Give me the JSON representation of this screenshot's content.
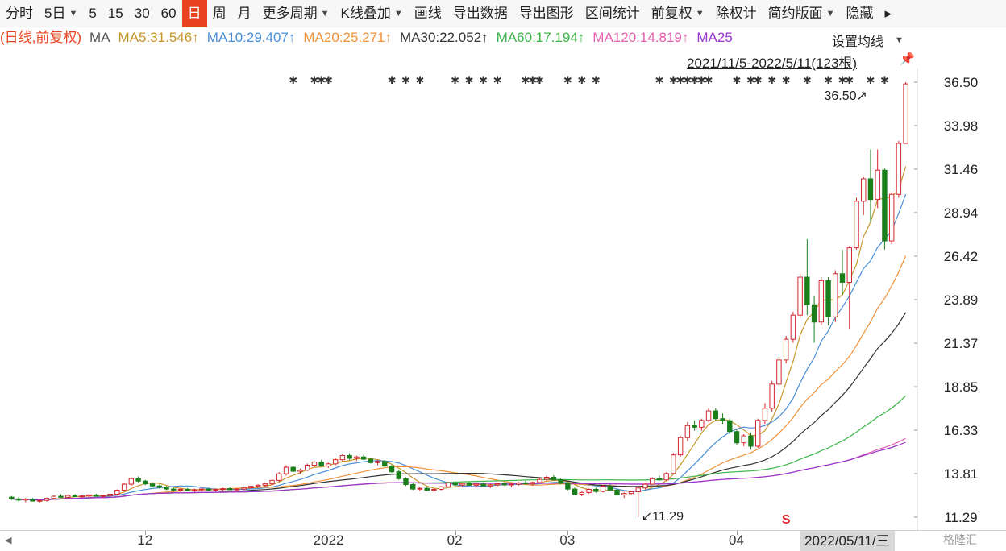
{
  "toolbar": {
    "items": [
      {
        "label": "分时",
        "dropdown": false,
        "active": false
      },
      {
        "label": "5日",
        "dropdown": true,
        "active": false
      },
      {
        "label": "5",
        "dropdown": false,
        "active": false
      },
      {
        "label": "15",
        "dropdown": false,
        "active": false
      },
      {
        "label": "30",
        "dropdown": false,
        "active": false
      },
      {
        "label": "60",
        "dropdown": false,
        "active": false
      },
      {
        "label": "日",
        "dropdown": false,
        "active": true
      },
      {
        "label": "周",
        "dropdown": false,
        "active": false
      },
      {
        "label": "月",
        "dropdown": false,
        "active": false
      },
      {
        "label": "更多周期",
        "dropdown": true,
        "active": false
      },
      {
        "label": "K线叠加",
        "dropdown": true,
        "active": false
      },
      {
        "label": "画线",
        "dropdown": false,
        "active": false
      },
      {
        "label": "导出数据",
        "dropdown": false,
        "active": false
      },
      {
        "label": "导出图形",
        "dropdown": false,
        "active": false
      },
      {
        "label": "区间统计",
        "dropdown": false,
        "active": false
      },
      {
        "label": "前复权",
        "dropdown": true,
        "active": false
      },
      {
        "label": "除权计",
        "dropdown": false,
        "active": false
      },
      {
        "label": "简约版面",
        "dropdown": true,
        "active": false
      },
      {
        "label": "隐藏",
        "dropdown": false,
        "active": false
      }
    ]
  },
  "legend": {
    "prefix": "(日线,前复权)",
    "ma_label": "MA",
    "items": [
      {
        "text": "MA5:31.546↑",
        "color": "#c8962c"
      },
      {
        "text": "MA10:29.407↑",
        "color": "#4a8fd8"
      },
      {
        "text": "MA20:25.271↑",
        "color": "#f0923a"
      },
      {
        "text": "MA30:22.052↑",
        "color": "#333333"
      },
      {
        "text": "MA60:17.194↑",
        "color": "#3bb548"
      },
      {
        "text": "MA120:14.819↑",
        "color": "#e561b0"
      },
      {
        "text": "MA25",
        "color": "#9933cc"
      }
    ]
  },
  "ma_settings_label": "设置均线",
  "range_label": "2021/11/5-2022/5/11(123根)",
  "date_badge": "2022/05/11/三",
  "watermark": "格隆汇",
  "colors": {
    "up": "#d3262e",
    "down": "#1a7f1a",
    "prefix": "#e8431f"
  },
  "chart_data": {
    "type": "candlestick",
    "y_ticks": [
      "36.50",
      "33.98",
      "31.46",
      "28.94",
      "26.42",
      "23.89",
      "21.37",
      "18.85",
      "16.33",
      "13.81",
      "11.29"
    ],
    "ylim": [
      11.29,
      36.5
    ],
    "x_ticks": [
      {
        "label": "12",
        "index": 19
      },
      {
        "label": "2022",
        "index": 44
      },
      {
        "label": "02",
        "index": 63
      },
      {
        "label": "03",
        "index": 79
      },
      {
        "label": "04",
        "index": 103
      }
    ],
    "annotations": [
      {
        "text": "36.50↗",
        "index": 122,
        "value": 36.5,
        "kind": "high"
      },
      {
        "text": "↙11.29",
        "index": 89,
        "value": 11.29,
        "kind": "low"
      },
      {
        "text": "S",
        "index": 110,
        "value": 11.29,
        "kind": "marker"
      }
    ],
    "news_marker_indices": [
      40,
      43,
      44,
      45,
      54,
      56,
      58,
      63,
      65,
      67,
      69,
      73,
      74,
      75,
      79,
      81,
      83,
      92,
      94,
      95,
      96,
      97,
      98,
      99,
      103,
      105,
      106,
      108,
      110,
      113,
      116,
      118,
      119,
      122,
      124
    ],
    "ohlc": [
      [
        12.45,
        12.52,
        12.28,
        12.35
      ],
      [
        12.35,
        12.45,
        12.2,
        12.28
      ],
      [
        12.28,
        12.4,
        12.15,
        12.34
      ],
      [
        12.34,
        12.4,
        12.2,
        12.22
      ],
      [
        12.22,
        12.32,
        12.14,
        12.26
      ],
      [
        12.26,
        12.42,
        12.2,
        12.38
      ],
      [
        12.38,
        12.55,
        12.3,
        12.5
      ],
      [
        12.5,
        12.62,
        12.4,
        12.44
      ],
      [
        12.44,
        12.58,
        12.38,
        12.55
      ],
      [
        12.55,
        12.62,
        12.45,
        12.48
      ],
      [
        12.48,
        12.56,
        12.4,
        12.52
      ],
      [
        12.52,
        12.62,
        12.46,
        12.58
      ],
      [
        12.58,
        12.65,
        12.48,
        12.5
      ],
      [
        12.5,
        12.58,
        12.42,
        12.54
      ],
      [
        12.54,
        12.66,
        12.5,
        12.62
      ],
      [
        12.62,
        12.9,
        12.55,
        12.85
      ],
      [
        12.85,
        13.25,
        12.78,
        13.2
      ],
      [
        13.2,
        13.6,
        13.1,
        13.52
      ],
      [
        13.52,
        13.65,
        13.3,
        13.38
      ],
      [
        13.38,
        13.45,
        13.15,
        13.22
      ],
      [
        13.22,
        13.3,
        13.05,
        13.1
      ],
      [
        13.1,
        13.18,
        12.95,
        13.02
      ],
      [
        13.02,
        13.1,
        12.86,
        12.92
      ],
      [
        12.92,
        13.0,
        12.8,
        12.86
      ],
      [
        12.86,
        12.96,
        12.78,
        12.9
      ],
      [
        12.9,
        12.98,
        12.8,
        12.84
      ],
      [
        12.84,
        12.94,
        12.76,
        12.88
      ],
      [
        12.88,
        12.98,
        12.8,
        12.92
      ],
      [
        12.92,
        13.0,
        12.82,
        12.86
      ],
      [
        12.86,
        12.96,
        12.78,
        12.9
      ],
      [
        12.9,
        13.0,
        12.82,
        12.94
      ],
      [
        12.94,
        13.02,
        12.85,
        12.88
      ],
      [
        12.88,
        12.98,
        12.8,
        12.92
      ],
      [
        12.92,
        13.05,
        12.86,
        13.0
      ],
      [
        13.0,
        13.12,
        12.92,
        13.08
      ],
      [
        13.08,
        13.2,
        13.0,
        13.14
      ],
      [
        13.14,
        13.3,
        13.05,
        13.22
      ],
      [
        13.22,
        13.5,
        13.15,
        13.42
      ],
      [
        13.42,
        13.9,
        13.35,
        13.8
      ],
      [
        13.8,
        14.3,
        13.7,
        14.18
      ],
      [
        14.18,
        14.25,
        13.9,
        13.95
      ],
      [
        13.95,
        14.1,
        13.8,
        14.02
      ],
      [
        14.02,
        14.4,
        13.95,
        14.3
      ],
      [
        14.3,
        14.55,
        14.2,
        14.48
      ],
      [
        14.48,
        14.6,
        14.2,
        14.25
      ],
      [
        14.25,
        14.45,
        14.15,
        14.38
      ],
      [
        14.38,
        14.7,
        14.3,
        14.62
      ],
      [
        14.62,
        14.95,
        14.5,
        14.86
      ],
      [
        14.86,
        15.0,
        14.6,
        14.7
      ],
      [
        14.7,
        14.85,
        14.55,
        14.78
      ],
      [
        14.78,
        14.9,
        14.6,
        14.65
      ],
      [
        14.65,
        14.72,
        14.4,
        14.45
      ],
      [
        14.45,
        14.6,
        14.3,
        14.52
      ],
      [
        14.52,
        14.6,
        14.2,
        14.25
      ],
      [
        14.25,
        14.32,
        13.85,
        13.92
      ],
      [
        13.92,
        14.0,
        13.45,
        13.52
      ],
      [
        13.52,
        13.6,
        13.1,
        13.18
      ],
      [
        13.18,
        13.25,
        12.85,
        12.92
      ],
      [
        12.92,
        13.02,
        12.78,
        12.96
      ],
      [
        12.96,
        13.05,
        12.8,
        12.85
      ],
      [
        12.85,
        12.96,
        12.7,
        12.9
      ],
      [
        12.9,
        13.1,
        12.84,
        13.05
      ],
      [
        13.05,
        13.35,
        13.0,
        13.28
      ],
      [
        13.28,
        13.4,
        13.1,
        13.16
      ],
      [
        13.16,
        13.3,
        13.05,
        13.24
      ],
      [
        13.24,
        13.34,
        13.1,
        13.14
      ],
      [
        13.14,
        13.26,
        13.0,
        13.2
      ],
      [
        13.2,
        13.3,
        13.05,
        13.1
      ],
      [
        13.1,
        13.22,
        12.98,
        13.16
      ],
      [
        13.16,
        13.28,
        13.05,
        13.22
      ],
      [
        13.22,
        13.32,
        13.1,
        13.16
      ],
      [
        13.16,
        13.26,
        13.02,
        13.2
      ],
      [
        13.2,
        13.34,
        13.1,
        13.28
      ],
      [
        13.28,
        13.4,
        13.18,
        13.22
      ],
      [
        13.22,
        13.35,
        13.12,
        13.3
      ],
      [
        13.3,
        13.55,
        13.25,
        13.48
      ],
      [
        13.48,
        13.7,
        13.38,
        13.6
      ],
      [
        13.6,
        13.72,
        13.4,
        13.46
      ],
      [
        13.46,
        13.55,
        13.2,
        13.25
      ],
      [
        13.25,
        13.3,
        12.85,
        12.92
      ],
      [
        12.92,
        13.0,
        12.55,
        12.62
      ],
      [
        12.62,
        12.8,
        12.5,
        12.72
      ],
      [
        12.72,
        12.95,
        12.65,
        12.9
      ],
      [
        12.9,
        13.0,
        12.7,
        12.78
      ],
      [
        12.78,
        13.15,
        12.72,
        13.08
      ],
      [
        13.08,
        13.2,
        12.8,
        12.86
      ],
      [
        12.86,
        12.92,
        12.5,
        12.58
      ],
      [
        12.58,
        12.72,
        12.4,
        12.66
      ],
      [
        12.66,
        12.82,
        12.58,
        12.76
      ],
      [
        12.76,
        13.05,
        11.29,
        12.98
      ],
      [
        12.98,
        13.25,
        12.9,
        13.2
      ],
      [
        13.2,
        13.6,
        13.15,
        13.52
      ],
      [
        13.52,
        13.7,
        13.4,
        13.45
      ],
      [
        13.45,
        13.9,
        13.4,
        13.82
      ],
      [
        13.82,
        15.0,
        13.8,
        14.9
      ],
      [
        14.9,
        16.0,
        14.8,
        15.9
      ],
      [
        15.9,
        16.8,
        15.7,
        16.6
      ],
      [
        16.6,
        16.9,
        16.3,
        16.5
      ],
      [
        16.5,
        17.0,
        16.3,
        16.9
      ],
      [
        16.9,
        17.6,
        16.8,
        17.45
      ],
      [
        17.45,
        17.6,
        16.9,
        17.0
      ],
      [
        17.0,
        17.3,
        16.7,
        16.88
      ],
      [
        16.88,
        17.0,
        16.1,
        16.25
      ],
      [
        16.25,
        16.4,
        15.5,
        15.6
      ],
      [
        15.6,
        16.1,
        15.4,
        16.0
      ],
      [
        16.0,
        16.2,
        15.2,
        15.4
      ],
      [
        15.4,
        17.0,
        15.3,
        16.9
      ],
      [
        16.9,
        17.9,
        16.7,
        17.6
      ],
      [
        17.6,
        19.2,
        17.4,
        19.0
      ],
      [
        19.0,
        20.6,
        18.8,
        20.4
      ],
      [
        20.4,
        21.8,
        20.2,
        21.6
      ],
      [
        21.6,
        23.2,
        21.4,
        23.0
      ],
      [
        23.0,
        25.4,
        22.8,
        25.2
      ],
      [
        25.2,
        27.4,
        23.0,
        23.6
      ],
      [
        23.6,
        24.1,
        21.4,
        22.6
      ],
      [
        22.6,
        25.2,
        22.4,
        25.0
      ],
      [
        25.0,
        25.2,
        22.4,
        22.9
      ],
      [
        22.9,
        25.6,
        22.6,
        25.4
      ],
      [
        25.4,
        26.8,
        24.2,
        24.9
      ],
      [
        24.9,
        27.0,
        22.2,
        26.9
      ],
      [
        26.9,
        29.8,
        26.8,
        29.6
      ],
      [
        29.6,
        31.0,
        28.8,
        30.9
      ],
      [
        30.9,
        32.6,
        28.4,
        29.7
      ],
      [
        29.7,
        32.6,
        29.2,
        31.4
      ],
      [
        31.4,
        31.5,
        26.8,
        27.3
      ],
      [
        27.3,
        30.1,
        27.1,
        30.0
      ],
      [
        30.0,
        33.1,
        29.8,
        32.95
      ],
      [
        32.95,
        36.5,
        33.9,
        36.4
      ]
    ]
  }
}
